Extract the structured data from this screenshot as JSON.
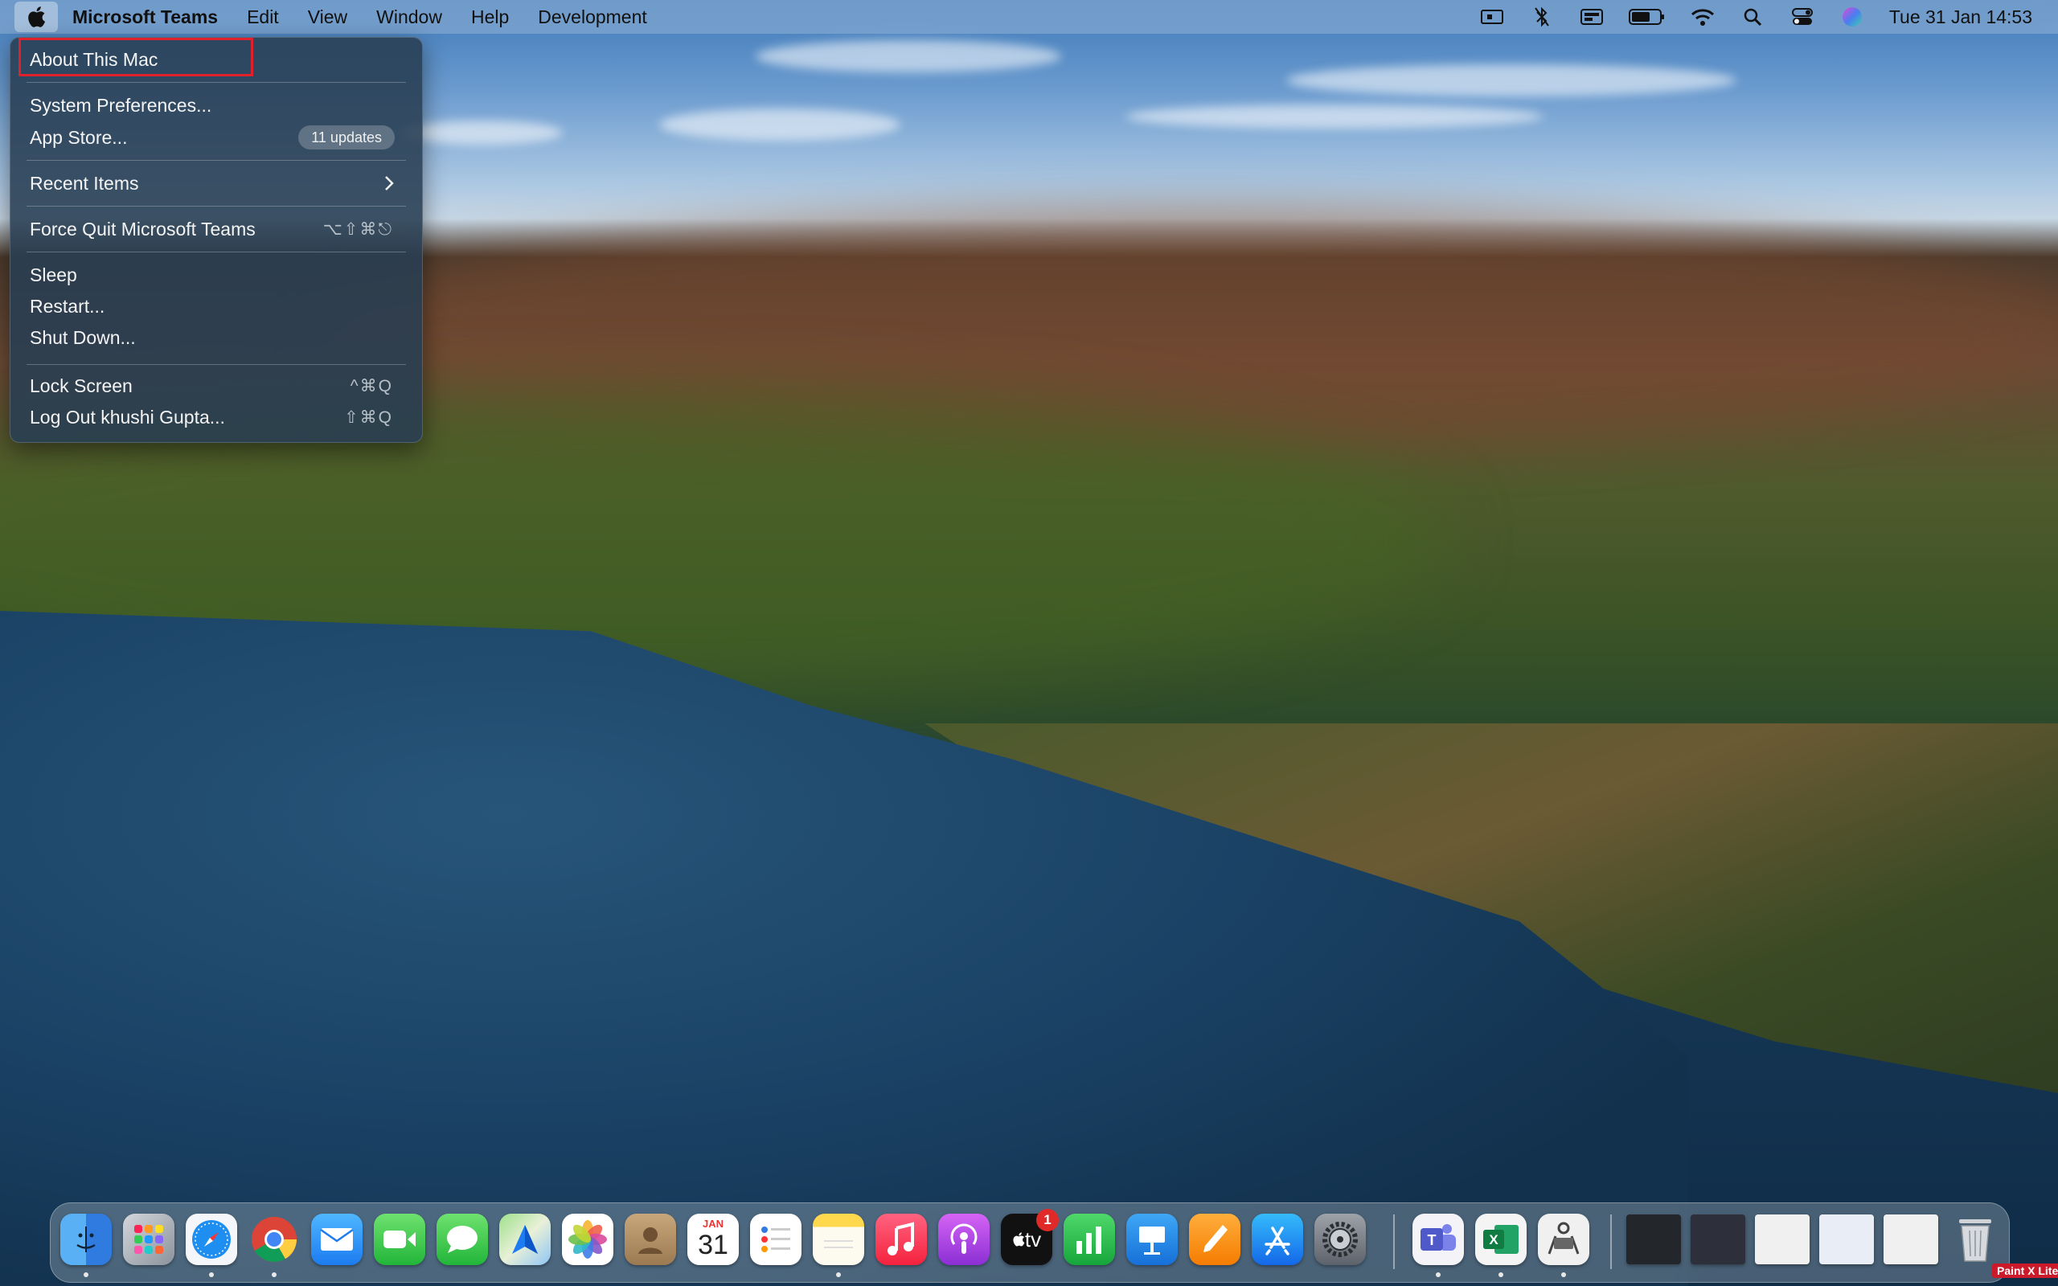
{
  "menubar": {
    "app_name": "Microsoft Teams",
    "menus": [
      "Edit",
      "View",
      "Window",
      "Help",
      "Development"
    ],
    "status_icons": [
      "screen-mirror-icon",
      "bluetooth-icon",
      "keyboard-input-icon",
      "battery-icon",
      "wifi-icon",
      "spotlight-search-icon",
      "control-center-icon",
      "siri-icon"
    ],
    "clock": "Tue 31 Jan  14:53"
  },
  "apple_menu": {
    "items": {
      "about": "About This Mac",
      "system_preferences": "System Preferences...",
      "app_store": "App Store...",
      "app_store_badge": "11 updates",
      "recent_items": "Recent Items",
      "force_quit": "Force Quit Microsoft Teams",
      "force_quit_shortcut": "⌥⇧⌘⎋",
      "sleep": "Sleep",
      "restart": "Restart...",
      "shut_down": "Shut Down...",
      "lock_screen": "Lock Screen",
      "lock_screen_shortcut": "^⌘Q",
      "log_out": "Log Out khushi Gupta...",
      "log_out_shortcut": "⇧⌘Q"
    },
    "highlight_color": "#e0202a"
  },
  "dock": {
    "apps": [
      "Finder",
      "Launchpad",
      "Safari",
      "Google Chrome",
      "Mail",
      "FaceTime",
      "Messages",
      "Maps",
      "Photos",
      "Contacts",
      "Calendar",
      "Reminders",
      "Notes",
      "Music",
      "Podcasts",
      "Apple TV",
      "Numbers",
      "Keynote",
      "Pages",
      "App Store",
      "System Preferences",
      "Microsoft Teams",
      "Microsoft Excel",
      "Screenshot Tool",
      "Trash"
    ],
    "calendar_month": "JAN",
    "calendar_day": "31",
    "appletv_label": "tv",
    "appletv_badge": "1",
    "excel_letter": "X",
    "teams_letter": "T"
  },
  "watermark": "Paint X Lite"
}
